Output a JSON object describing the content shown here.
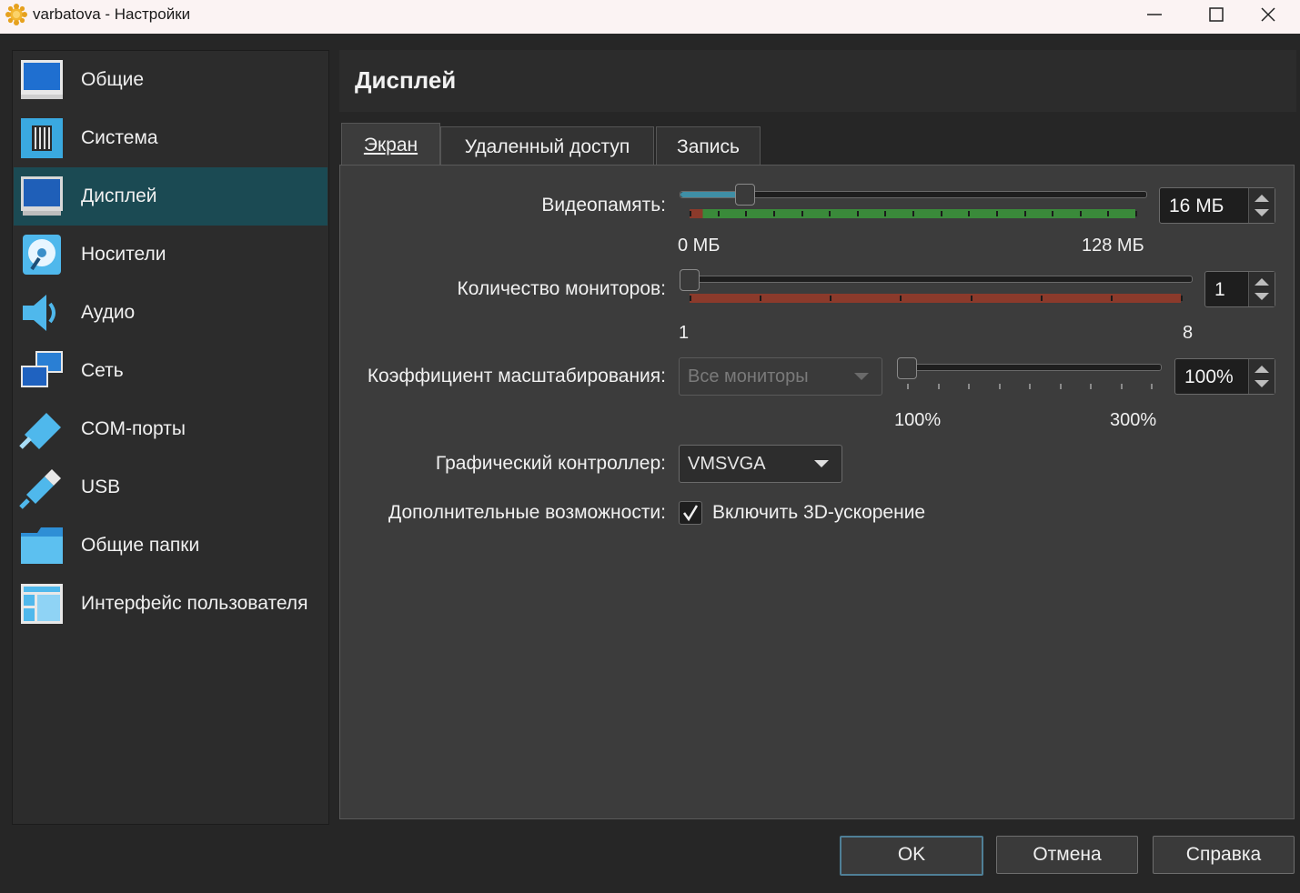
{
  "window": {
    "title": "varbatova - Настройки"
  },
  "sidebar": {
    "items": [
      {
        "label": "Общие",
        "icon": "general-monitor-icon"
      },
      {
        "label": "Система",
        "icon": "chip-icon"
      },
      {
        "label": "Дисплей",
        "icon": "display-icon",
        "active": true
      },
      {
        "label": "Носители",
        "icon": "storage-disc-icon"
      },
      {
        "label": "Аудио",
        "icon": "speaker-icon"
      },
      {
        "label": "Сеть",
        "icon": "network-icon"
      },
      {
        "label": "COM-порты",
        "icon": "serial-port-icon"
      },
      {
        "label": "USB",
        "icon": "usb-icon"
      },
      {
        "label": "Общие папки",
        "icon": "folder-icon"
      },
      {
        "label": "Интерфейс пользователя",
        "icon": "user-interface-icon"
      }
    ]
  },
  "header": {
    "title": "Дисплей"
  },
  "tabs": [
    {
      "label": "Экран",
      "active": true
    },
    {
      "label": "Удаленный доступ"
    },
    {
      "label": "Запись"
    }
  ],
  "screen": {
    "video_memory": {
      "label": "Видеопамять:",
      "value": "16 МБ",
      "min_label": "0 МБ",
      "max_label": "128 МБ",
      "level": 0.125
    },
    "monitors": {
      "label": "Количество мониторов:",
      "value": "1",
      "min_label": "1",
      "max_label": "8",
      "level": 0
    },
    "scale": {
      "label": "Коэффициент масштабирования:",
      "combo_value": "Все мониторы",
      "value": "100%",
      "min_label": "100%",
      "max_label": "300%",
      "level": 0
    },
    "controller": {
      "label": "Графический контроллер:",
      "value": "VMSVGA"
    },
    "extras": {
      "label": "Дополнительные возможности:",
      "checkbox_label": "Включить 3D-ускорение",
      "checked": true
    }
  },
  "buttons": {
    "ok": "OK",
    "cancel": "Отмена",
    "help": "Справка"
  },
  "colors": {
    "accent": "#1b4a53",
    "slider_fill": "#3f8fa6",
    "green_zone": "#3a8a3a",
    "red_zone": "#8b3a2b"
  }
}
